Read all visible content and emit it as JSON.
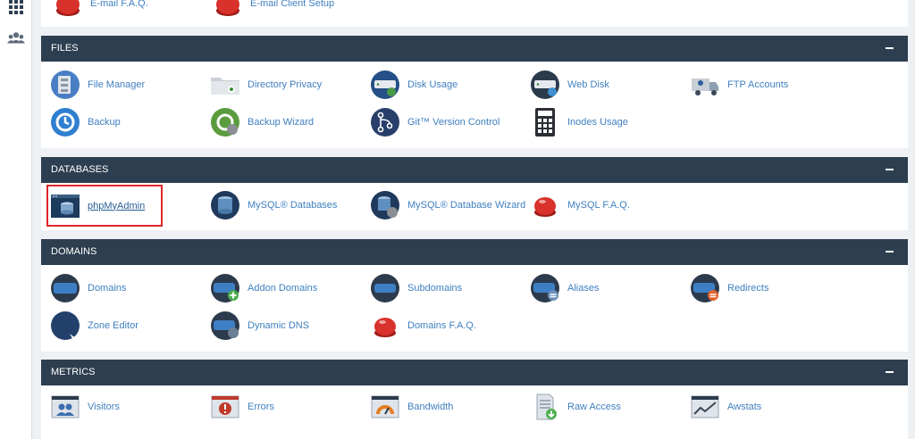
{
  "colors": {
    "header_bg": "#2d3e50",
    "link": "#3f7fbf",
    "highlight": "#e0262a",
    "page_bg": "#eef1f4"
  },
  "sidebar": {
    "icons": [
      "apps-grid-icon",
      "users-icon"
    ]
  },
  "email_row": {
    "items": [
      {
        "label": "E-mail F.A.Q.",
        "icon": "help-button-icon"
      },
      {
        "label": "E-mail Client Setup",
        "icon": "help-button-icon"
      }
    ]
  },
  "files": {
    "title": "FILES",
    "items": [
      {
        "label": "File Manager",
        "icon": "file-cabinet-icon"
      },
      {
        "label": "Directory Privacy",
        "icon": "folder-eye-icon"
      },
      {
        "label": "Disk Usage",
        "icon": "disk-usage-icon"
      },
      {
        "label": "Web Disk",
        "icon": "web-disk-icon"
      },
      {
        "label": "FTP Accounts",
        "icon": "ftp-truck-icon"
      },
      {
        "label": "Backup",
        "icon": "backup-clock-icon"
      },
      {
        "label": "Backup Wizard",
        "icon": "backup-wizard-icon"
      },
      {
        "label": "Git™ Version Control",
        "icon": "git-branch-icon"
      },
      {
        "label": "Inodes Usage",
        "icon": "inodes-calculator-icon"
      }
    ]
  },
  "databases": {
    "title": "DATABASES",
    "items": [
      {
        "label": "phpMyAdmin",
        "icon": "phpmyadmin-icon"
      },
      {
        "label": "MySQL® Databases",
        "icon": "database-icon"
      },
      {
        "label": "MySQL® Database Wizard",
        "icon": "database-wizard-icon"
      },
      {
        "label": "MySQL F.A.Q.",
        "icon": "help-button-icon"
      }
    ]
  },
  "domains": {
    "title": "DOMAINS",
    "items": [
      {
        "label": "Domains",
        "icon": "dotcom-icon"
      },
      {
        "label": "Addon Domains",
        "icon": "addon-domain-icon"
      },
      {
        "label": "Subdomains",
        "icon": "subdomain-icon"
      },
      {
        "label": "Aliases",
        "icon": "alias-domain-icon"
      },
      {
        "label": "Redirects",
        "icon": "redirect-domain-icon"
      },
      {
        "label": "Zone Editor",
        "icon": "dns-zone-icon"
      },
      {
        "label": "Dynamic DNS",
        "icon": "dynamic-dns-icon"
      },
      {
        "label": "Domains F.A.Q.",
        "icon": "help-button-icon"
      }
    ]
  },
  "metrics": {
    "title": "METRICS",
    "items": [
      {
        "label": "Visitors",
        "icon": "visitors-icon"
      },
      {
        "label": "Errors",
        "icon": "errors-icon"
      },
      {
        "label": "Bandwidth",
        "icon": "bandwidth-gauge-icon"
      },
      {
        "label": "Raw Access",
        "icon": "raw-access-icon"
      },
      {
        "label": "Awstats",
        "icon": "awstats-chart-icon"
      }
    ]
  },
  "collapse_symbol": "−"
}
